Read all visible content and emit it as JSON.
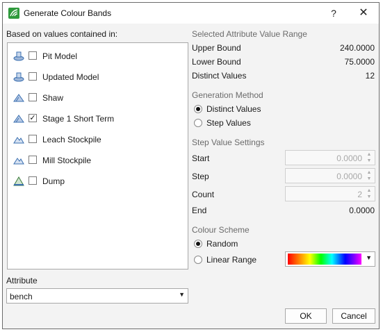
{
  "window": {
    "title": "Generate Colour Bands",
    "help_glyph": "?",
    "close_glyph": "✕"
  },
  "left": {
    "based_on_label": "Based on values contained in:",
    "items": [
      {
        "label": "Pit Model",
        "icon": "block-model-icon",
        "checked": false,
        "check_glyph": ""
      },
      {
        "label": "Updated Model",
        "icon": "block-model-icon",
        "checked": false,
        "check_glyph": ""
      },
      {
        "label": "Shaw",
        "icon": "pit-design-icon",
        "checked": false,
        "check_glyph": ""
      },
      {
        "label": "Stage 1 Short Term",
        "icon": "pit-design-icon",
        "checked": true,
        "check_glyph": "✓"
      },
      {
        "label": "Leach Stockpile",
        "icon": "stockpile-icon",
        "checked": false,
        "check_glyph": ""
      },
      {
        "label": "Mill Stockpile",
        "icon": "stockpile-icon",
        "checked": false,
        "check_glyph": ""
      },
      {
        "label": "Dump",
        "icon": "dump-icon",
        "checked": false,
        "check_glyph": ""
      }
    ],
    "attribute_label": "Attribute",
    "attribute_value": "bench",
    "dropdown_glyph": "▼"
  },
  "right": {
    "range_heading": "Selected Attribute Value Range",
    "upper_bound_label": "Upper Bound",
    "upper_bound_value": "240.0000",
    "lower_bound_label": "Lower Bound",
    "lower_bound_value": "75.0000",
    "distinct_values_label": "Distinct Values",
    "distinct_values_value": "12",
    "method_heading": "Generation Method",
    "method_distinct": "Distinct Values",
    "method_step": "Step Values",
    "method_selected": "Distinct Values",
    "step_heading": "Step Value Settings",
    "start_label": "Start",
    "start_value": "0.0000",
    "step_label": "Step",
    "step_value": "0.0000",
    "count_label": "Count",
    "count_value": "2",
    "end_label": "End",
    "end_value": "0.0000",
    "scheme_heading": "Colour Scheme",
    "scheme_random": "Random",
    "scheme_linear": "Linear Range",
    "scheme_selected": "Random",
    "spin_up_glyph": "▲",
    "spin_down_glyph": "▼"
  },
  "buttons": {
    "ok": "OK",
    "cancel": "Cancel"
  },
  "colors": {
    "accent_icon": "#2f9a3c",
    "icon_blue": "#3a6fb0",
    "disabled_text": "#a8a8a8"
  }
}
